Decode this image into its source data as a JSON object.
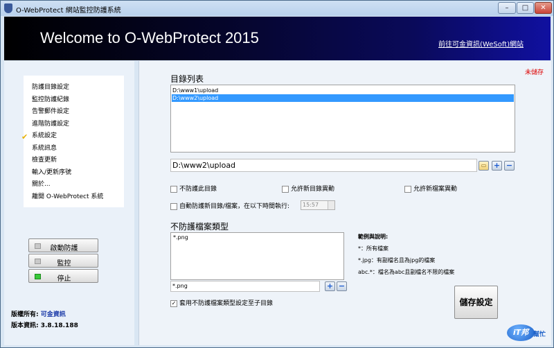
{
  "window": {
    "title": "O-WebProtect 網站監控防護系統",
    "min": "–",
    "max": "□",
    "close": "✕"
  },
  "header": {
    "welcome": "Welcome to O-WebProtect 2015",
    "link": "前往可金資訊(WeSoft)網站"
  },
  "sidebar": {
    "menu": [
      "防護目錄設定",
      "監控防護紀錄",
      "告警郵件設定",
      "進階防護設定",
      "系統設定",
      "系統訊息",
      "檢查更新",
      "輸入/更新序號",
      "關於...",
      "離開 O-WebProtect 系統"
    ],
    "selected_index": 3,
    "check_glyph": "✔",
    "buttons": {
      "start": "啟動防護",
      "monitor": "監控",
      "stop": "停止"
    },
    "copyright_label": "版權所有:",
    "copyright_value": "可金資訊",
    "version_label": "版本資訊:",
    "version_value": "3.8.18.188"
  },
  "main": {
    "unsaved": "未儲存",
    "dir_list_title": "目錄列表",
    "dir_list": [
      "D:\\www1\\upload",
      "D:\\www2\\upload"
    ],
    "selected_dir": 1,
    "path_value": "D:\\www2\\upload",
    "icons": {
      "folder": "▭",
      "plus": "+",
      "minus": "−"
    },
    "options": {
      "no_protect_dir": "不防護此目錄",
      "allow_new_dir": "允許新目錄異動",
      "allow_new_file": "允許新檔案異動",
      "auto_protect": "自動防護新目錄/檔案，在以下時間執行:",
      "time": "15:57"
    },
    "no_protect_types_title": "不防護檔案類型",
    "ext_list": [
      "*.png"
    ],
    "ext_input": "*.png",
    "apply_subdirs": "套用不防護檔案類型設定至子目錄",
    "apply_subdirs_checked": true,
    "notes_title": "範例與說明:",
    "notes": [
      "*：所有檔案",
      "*.jpg：有副檔名且為jpg的檔案",
      "abc.*：檔名為abc且副檔名不限的檔案"
    ],
    "save_button": "儲存設定"
  },
  "watermark": {
    "logo": "iT邦",
    "text": "幫忙"
  }
}
